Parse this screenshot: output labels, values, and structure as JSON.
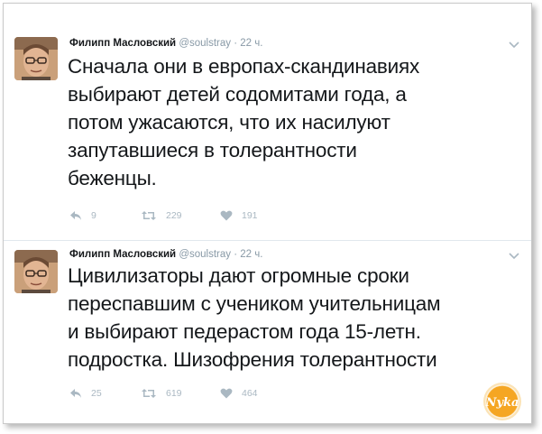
{
  "tweets": [
    {
      "author_name": "Филипп Масловский",
      "handle": "@soulstray",
      "separator": "·",
      "time": "22 ч.",
      "text_lines": [
        "Сначала они в европах-скандинавиях",
        "выбирают детей содомитами года, а",
        "потом ужасаются, что их насилуют",
        "запутавшиеся в толерантности",
        "беженцы."
      ],
      "replies": "9",
      "retweets": "229",
      "likes": "191"
    },
    {
      "author_name": "Филипп Масловский",
      "handle": "@soulstray",
      "separator": "·",
      "time": "22 ч.",
      "text_lines": [
        "Цивилизаторы дают огромные сроки",
        "переспавшим с учеником учительницам",
        "и выбирают педерастом года 15-летн.",
        "подростка. Шизофрения толерантности"
      ],
      "replies": "25",
      "retweets": "619",
      "likes": "464"
    }
  ],
  "watermark": {
    "text": "Nyka",
    "color": "#f5a623"
  },
  "colors": {
    "text": "#14171a",
    "meta": "#8899a6",
    "action": "#aab8c2",
    "divider": "#e1e8ed"
  },
  "icons": [
    "avatar-photo",
    "chevron-down-icon",
    "reply-icon",
    "retweet-icon",
    "like-icon",
    "watermark-logo"
  ]
}
